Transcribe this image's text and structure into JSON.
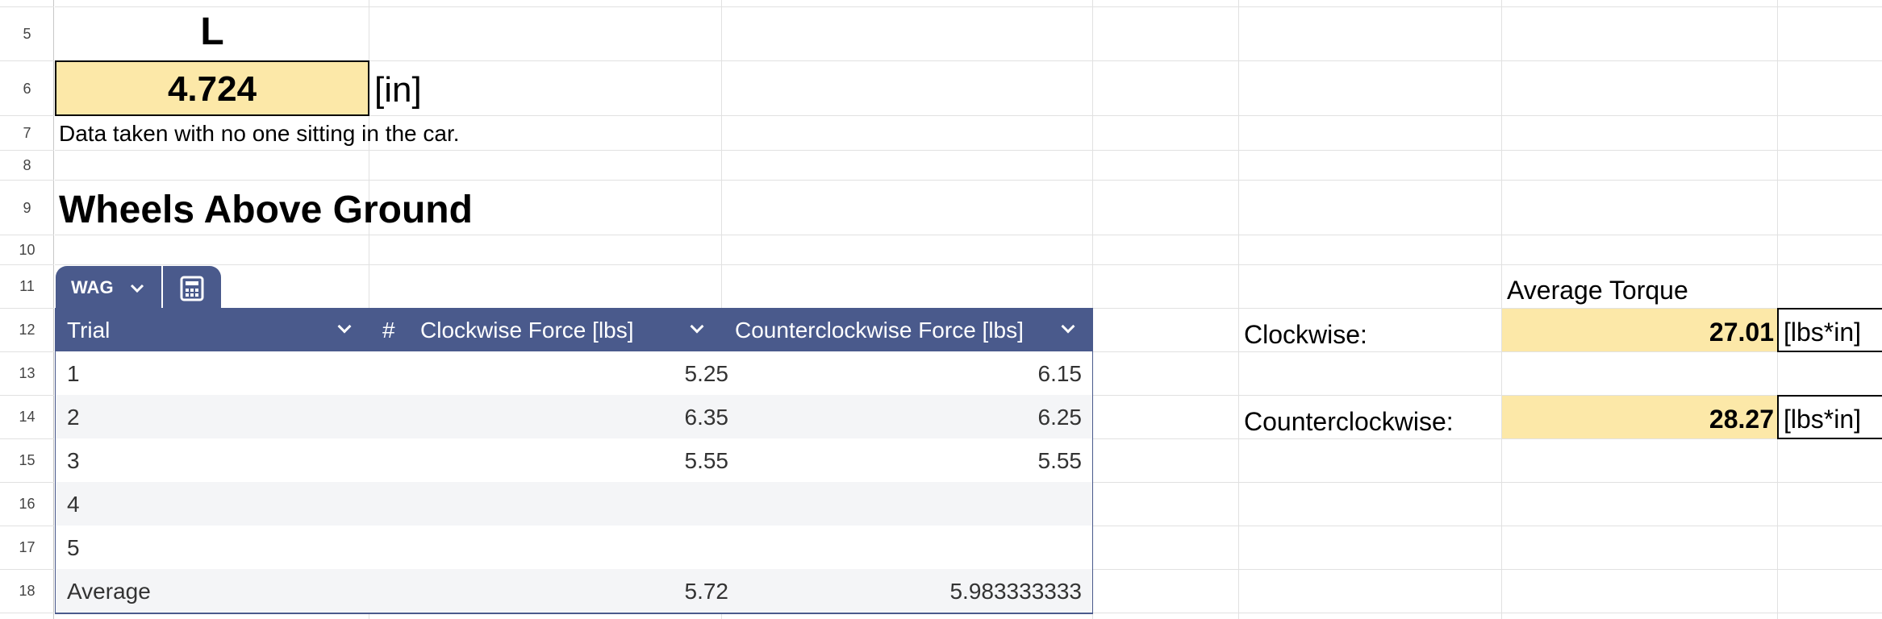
{
  "rows": [
    "5",
    "6",
    "7",
    "8",
    "9",
    "10",
    "11",
    "12",
    "13",
    "14",
    "15",
    "16",
    "17",
    "18"
  ],
  "l_header": "L",
  "l_value": "4.724",
  "l_unit": "[in]",
  "note": "Data taken with no one sitting in the car.",
  "section_title": "Wheels Above Ground",
  "table": {
    "name": "WAG",
    "name_icon": "chevron-down-icon",
    "calc_icon": "calculator-icon",
    "header_color": "#4a5a8c",
    "columns": [
      {
        "label": "Trial",
        "type_icon": ""
      },
      {
        "label": "Clockwise Force [lbs]",
        "type_icon": "#"
      },
      {
        "label": "Counterclockwise Force [lbs]",
        "type_icon": ""
      }
    ],
    "rows": [
      {
        "trial": "1",
        "cw": "5.25",
        "ccw": "6.15"
      },
      {
        "trial": "2",
        "cw": "6.35",
        "ccw": "6.25"
      },
      {
        "trial": "3",
        "cw": "5.55",
        "ccw": "5.55"
      },
      {
        "trial": "4",
        "cw": "",
        "ccw": ""
      },
      {
        "trial": "5",
        "cw": "",
        "ccw": ""
      },
      {
        "trial": "Average",
        "cw": "5.72",
        "ccw": "5.983333333"
      }
    ]
  },
  "torque": {
    "title": "Average Torque",
    "clockwise_label": "Clockwise:",
    "clockwise_value": "27.01",
    "clockwise_unit": "[lbs*in]",
    "ccw_label": "Counterclockwise:",
    "ccw_value": "28.27",
    "ccw_unit": "[lbs*in]",
    "highlight_color": "#fce8a8"
  }
}
